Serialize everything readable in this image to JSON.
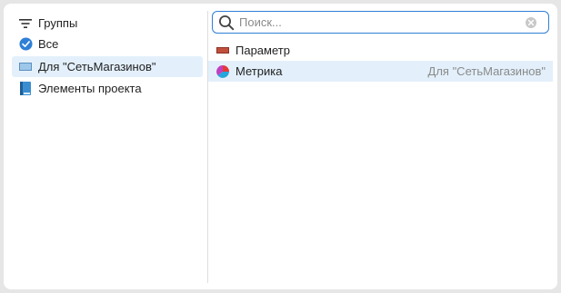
{
  "groups": {
    "header_label": "Группы",
    "items": [
      {
        "label": "Все",
        "icon": "check-circle-icon",
        "selected": false
      },
      {
        "label": "Для \"СетьМагазинов\"",
        "icon": "rectangle-icon",
        "selected": true
      },
      {
        "label": "Элементы проекта",
        "icon": "book-icon",
        "selected": false
      }
    ]
  },
  "search": {
    "placeholder": "Поиск...",
    "value": ""
  },
  "results": [
    {
      "label": "Параметр",
      "icon": "parameter-icon",
      "scope": "",
      "selected": false
    },
    {
      "label": "Метрика",
      "icon": "metric-pie-icon",
      "scope": "Для \"СетьМагазинов\"",
      "selected": true
    }
  ],
  "colors": {
    "accent": "#2f7fd6",
    "selection": "#e3f0fb",
    "muted_text": "#8a8a8a"
  }
}
